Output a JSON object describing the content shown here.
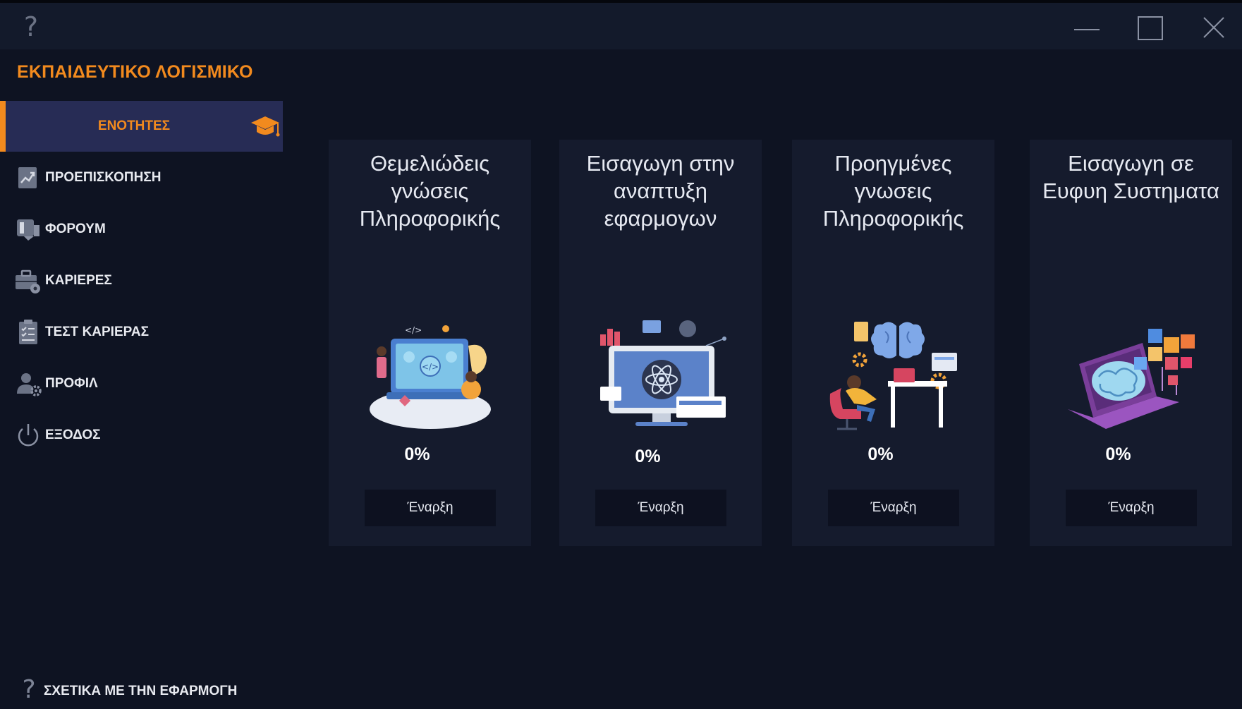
{
  "window": {
    "help_icon": "help-icon",
    "help_glyph": "?",
    "controls": [
      "minimize-icon",
      "maximize-icon",
      "close-icon"
    ]
  },
  "app": {
    "title": "ΕΚΠΑΙΔΕΥΤΙΚΟ ΛΟΓΙΣΜΙΚΟ",
    "accent_color": "#f28a1e"
  },
  "sidebar": {
    "active": {
      "label": "ΕΝΟΤΗΤΕΣ",
      "icon": "graduation-cap-icon"
    },
    "items": [
      {
        "label": "ΠΡΟΕΠΙΣΚΟΠΗΣΗ",
        "icon": "chart-trend-icon"
      },
      {
        "label": "ΦΟΡΟΥΜ",
        "icon": "forum-icon"
      },
      {
        "label": "ΚΑΡΙΕΡΕΣ",
        "icon": "briefcase-icon"
      },
      {
        "label": "ΤΕΣΤ ΚΑΡΙΕΡΑΣ",
        "icon": "clipboard-checklist-icon"
      },
      {
        "label": "ΠΡΟΦΙΛ",
        "icon": "user-settings-icon"
      },
      {
        "label": "ΕΞΟΔΟΣ",
        "icon": "power-icon"
      }
    ],
    "footer": {
      "label": "ΣΧΕΤΙΚΑ ΜΕ ΤΗΝ ΕΦΑΡΜΟΓΗ",
      "icon": "question-icon",
      "glyph": "?"
    }
  },
  "modules": [
    {
      "title": "Θεμελιώδεις γνώσεις Πληροφορικής",
      "progress": "0%",
      "button": "Έναρξη",
      "illustration": "coding-laptop-illustration"
    },
    {
      "title": "Εισαγωγη στην αναπτυξη εφαρμογων",
      "progress": "0%",
      "button": "Έναρξη",
      "illustration": "app-development-monitor-illustration"
    },
    {
      "title": "Προηγμένες γνωσεις Πληροφορικής",
      "progress": "0%",
      "button": "Έναρξη",
      "illustration": "advanced-brain-desk-illustration"
    },
    {
      "title": "Εισαγωγη σε Ευφυη Συστηματα",
      "progress": "0%",
      "button": "Έναρξη",
      "illustration": "ai-brain-laptop-illustration"
    }
  ]
}
